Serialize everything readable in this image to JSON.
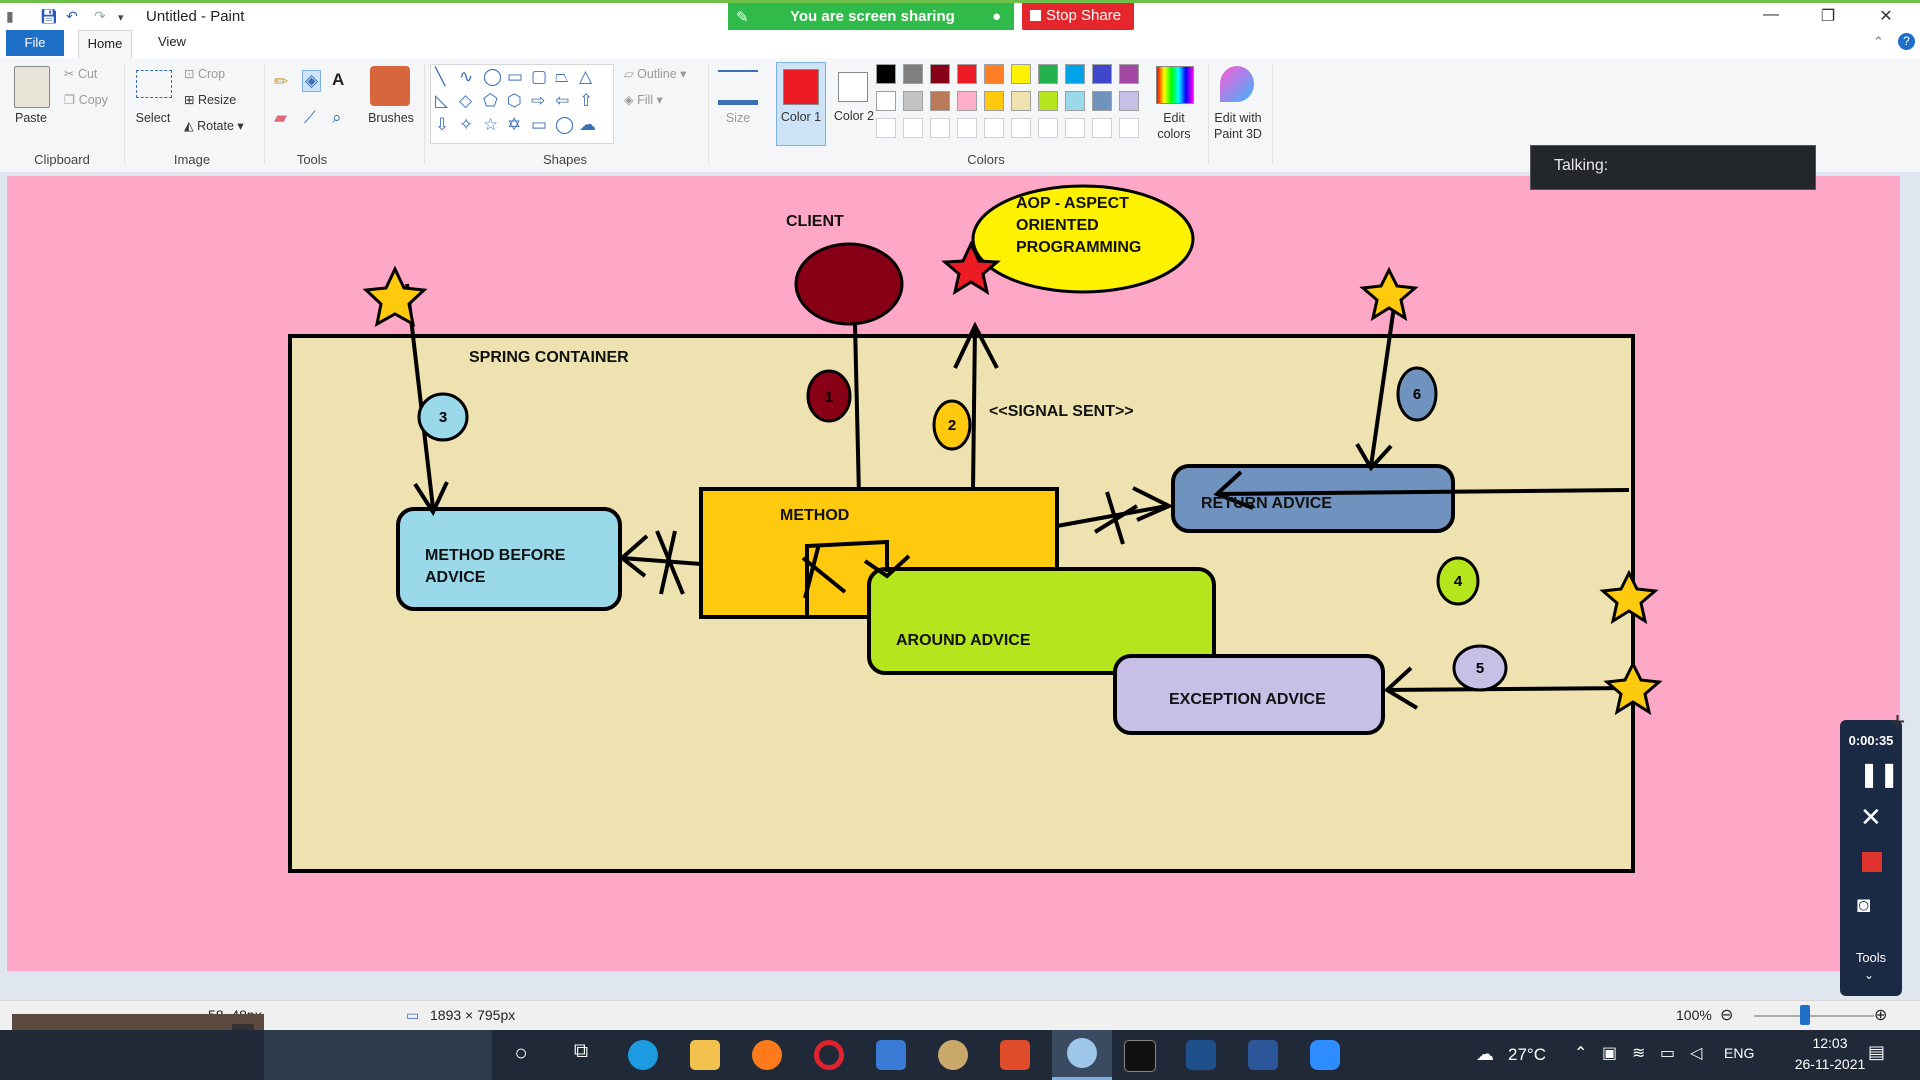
{
  "titlebar": {
    "title": "Untitled - Paint",
    "share_status": "You are screen sharing",
    "stop_share": "Stop Share"
  },
  "tabs": {
    "file": "File",
    "home": "Home",
    "view": "View"
  },
  "ribbon": {
    "clipboard": {
      "paste": "Paste",
      "cut": "Cut",
      "copy": "Copy",
      "group": "Clipboard"
    },
    "image": {
      "select": "Select",
      "crop": "Crop",
      "resize": "Resize",
      "rotate": "Rotate",
      "group": "Image"
    },
    "tools": {
      "group": "Tools",
      "brushes": "Brushes"
    },
    "shapes": {
      "outline": "Outline",
      "fill": "Fill",
      "group": "Shapes"
    },
    "size": "Size",
    "color1": "Color 1",
    "color2": "Color 2",
    "colors_group": "Colors",
    "edit_colors": "Edit colors",
    "paint3d": "Edit with Paint 3D",
    "color1_value": "#ed1c24",
    "color2_value": "#ffffff",
    "palette_row1": [
      "#000000",
      "#7f7f7f",
      "#880015",
      "#ed1c24",
      "#ff7f27",
      "#fff200",
      "#22b14c",
      "#00a2e8",
      "#3f48cc",
      "#a349a4"
    ],
    "palette_row2": [
      "#ffffff",
      "#c3c3c3",
      "#b97a57",
      "#ffaec9",
      "#ffc90e",
      "#efe4b0",
      "#b5e61d",
      "#99d9ea",
      "#7092be",
      "#c8bfe7"
    ]
  },
  "overlay": {
    "talking": "Talking:"
  },
  "recorder": {
    "timer": "0:00:35",
    "tools": "Tools"
  },
  "diagram": {
    "client": "CLIENT",
    "aop": [
      "AOP - ASPECT",
      "ORIENTED",
      "PROGRAMMING"
    ],
    "container": "SPRING CONTAINER",
    "signal": "<<SIGNAL SENT>>",
    "method": "METHOD",
    "before": [
      "METHOD BEFORE",
      "ADVICE"
    ],
    "returning": "RETURN ADVICE",
    "around": "AROUND ADVICE",
    "exception": "EXCEPTION ADVICE",
    "badges": [
      "1",
      "2",
      "3",
      "4",
      "5",
      "6"
    ]
  },
  "statusbar": {
    "cursor": "58, 48px",
    "canvas_size": "1893 × 795px",
    "zoom": "100%"
  },
  "taskbar": {
    "temperature": "27°C",
    "lang": "ENG",
    "time": "12:03",
    "date": "26-11-2021"
  }
}
